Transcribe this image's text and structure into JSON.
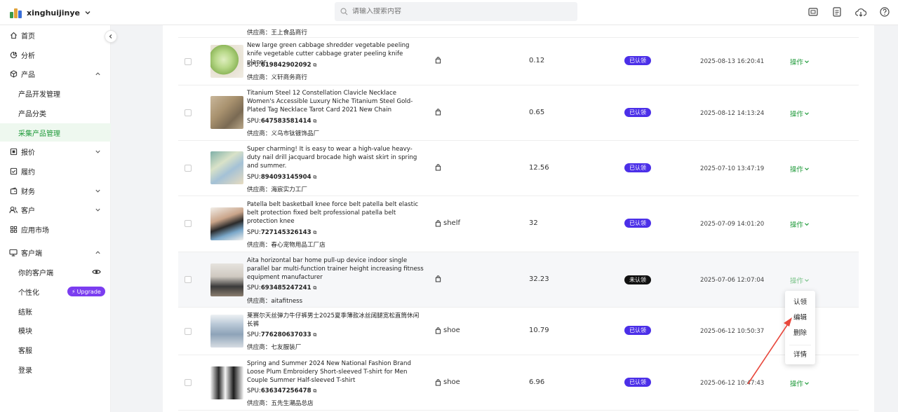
{
  "header": {
    "brand_name": "xinghuijinye",
    "search_placeholder": "请输入搜索内容"
  },
  "sidebar": {
    "items": [
      {
        "label": "首页",
        "icon": "home-icon"
      },
      {
        "label": "分析",
        "icon": "analysis-icon"
      },
      {
        "label": "产品",
        "icon": "cube-icon",
        "expanded": true
      },
      {
        "label": "产品开发管理"
      },
      {
        "label": "产品分类"
      },
      {
        "label": "采集产品管理",
        "active": true
      },
      {
        "label": "报价",
        "icon": "quote-icon"
      },
      {
        "label": "履约",
        "icon": "fulfill-icon"
      },
      {
        "label": "财务",
        "icon": "finance-icon"
      },
      {
        "label": "客户",
        "icon": "customer-icon"
      },
      {
        "label": "应用市场",
        "icon": "apps-icon"
      },
      {
        "label": "客户端",
        "icon": "monitor-icon",
        "expanded": true
      },
      {
        "label": "你的客户端"
      },
      {
        "label": "个性化"
      },
      {
        "label": "结账"
      },
      {
        "label": "模块"
      },
      {
        "label": "客服"
      },
      {
        "label": "登录"
      }
    ],
    "upgrade_label": "Upgrade"
  },
  "table": {
    "partial_top_supplier": "供应商：王上食品商行",
    "rows": [
      {
        "title": "New large green cabbage shredder vegetable peeling knife vegetable cutter cabbage grater peeling knife planer",
        "spu_label": "SPU:",
        "spu": "619842902092",
        "supplier": "供应商：义轩商务商行",
        "tag": "",
        "price": "0.12",
        "status": "已认领",
        "date": "2025-08-13 16:20:41",
        "op": "操作"
      },
      {
        "title": "Titanium Steel 12 Constellation Clavicle Necklace Women's Accessible Luxury Niche Titanium Steel Gold-Plated Tag Necklace Tarot Card 2021 New Chain",
        "spu_label": "SPU:",
        "spu": "647583581414",
        "supplier": "供应商：义乌市钛镀饰品厂",
        "tag": "",
        "price": "0.65",
        "status": "已认领",
        "date": "2025-08-12 14:13:24",
        "op": "操作"
      },
      {
        "title": "Super charming! It is easy to wear a high-value heavy-duty nail drill jacquard brocade high waist skirt in spring and summer.",
        "spu_label": "SPU:",
        "spu": "894093145904",
        "supplier": "供应商：海宸实力工厂",
        "tag": "",
        "price": "12.56",
        "status": "已认领",
        "date": "2025-07-10 13:47:19",
        "op": "操作"
      },
      {
        "title": "Patella belt basketball knee force belt patella belt elastic belt protection fixed belt professional patella belt protection knee",
        "spu_label": "SPU:",
        "spu": "727145326143",
        "supplier": "供应商：春心宠物用品工厂店",
        "tag": "shelf",
        "price": "32",
        "status": "已认领",
        "date": "2025-07-09 14:01:20",
        "op": "操作"
      },
      {
        "title": "Aita horizontal bar home pull-up device indoor single parallel bar multi-function trainer height increasing fitness equipment manufacturer",
        "spu_label": "SPU:",
        "spu": "693485247241",
        "supplier": "供应商：aitafitness",
        "tag": "",
        "price": "32.23",
        "status": "未认领",
        "date": "2025-07-06 12:07:04",
        "op": "操作"
      },
      {
        "title": "莱赛尔天丝弹力牛仔裤男士2025夏季薄款冰丝阔腿宽松直筒休闲长裤",
        "spu_label": "SPU:",
        "spu": "776280637033",
        "supplier": "供应商：七友服装厂",
        "tag": "shoe",
        "price": "10.79",
        "status": "已认领",
        "date": "2025-06-12 10:50:37",
        "op": "操作"
      },
      {
        "title": "Spring and Summer 2024 New National Fashion Brand Loose Plum Embroidery Short-sleeved T-shirt for Men Couple Summer Half-sleeved T-shirt",
        "spu_label": "SPU:",
        "spu": "636347256478",
        "supplier": "供应商：五先生潮品总店",
        "tag": "shoe",
        "price": "6.96",
        "status": "已认领",
        "date": "2025-06-12 10:47:43",
        "op": "操作"
      }
    ]
  },
  "dropdown": {
    "items": [
      "认领",
      "编辑",
      "删除",
      "详情"
    ]
  },
  "colors": {
    "accent_green": "#1f9a3a",
    "claimed_badge": "#4b2fe8",
    "unclaimed_badge": "#111111",
    "upgrade_badge": "#7b3df0",
    "annotation_arrow": "#e8473c"
  }
}
